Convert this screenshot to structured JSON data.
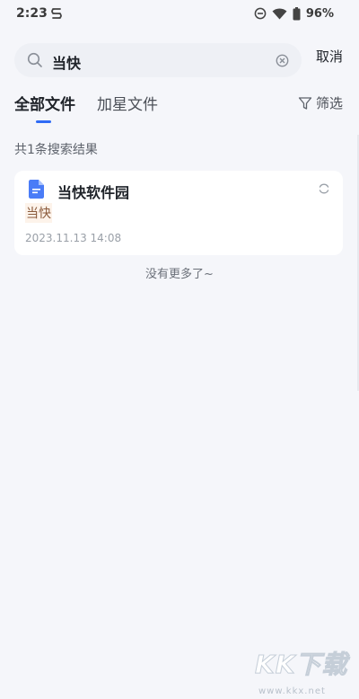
{
  "status_bar": {
    "time": "2:23",
    "battery_percent": "96%",
    "icons": [
      "app-notification-icon",
      "do-not-disturb-icon",
      "wifi-icon",
      "battery-icon"
    ]
  },
  "search": {
    "value": "当快",
    "cancel_label": "取消"
  },
  "tabs": {
    "all_label": "全部文件",
    "starred_label": "加星文件",
    "active": "all"
  },
  "filter": {
    "label": "筛选"
  },
  "results": {
    "count_text": "共1条搜索结果",
    "items": [
      {
        "file_name": "当快软件园",
        "snippet": "当快",
        "date": "2023.11.13 14:08"
      }
    ],
    "end_text": "没有更多了~"
  },
  "watermark": {
    "text": "KK下载",
    "url": "www.kkx.net"
  },
  "colors": {
    "accent": "#2f6bf5",
    "background": "#f5f6fa",
    "doc_icon": "#4a7cf7",
    "snippet_highlight": "#fdf3ea"
  }
}
